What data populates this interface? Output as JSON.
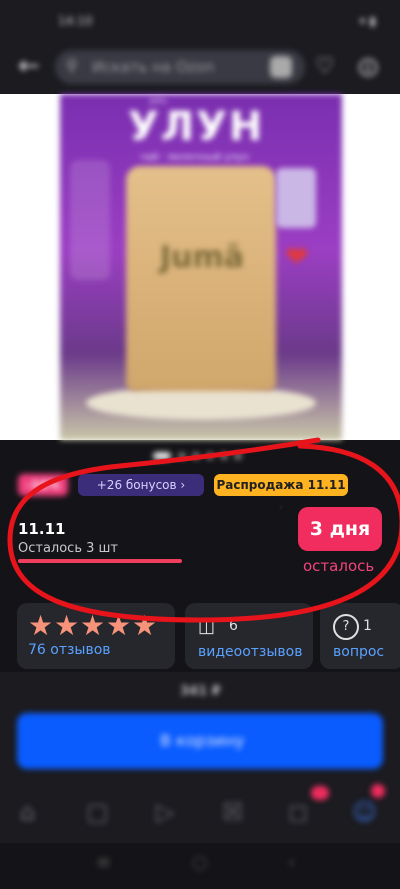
{
  "status_bar": {
    "time": "14:10",
    "right": "▾ ▮"
  },
  "search": {
    "placeholder": "Искать на Ozon"
  },
  "product_image": {
    "title": "УЛУН",
    "subtitle": "чай · молочный улун",
    "brand_small": "Julu",
    "pouch_logo": "Jumā"
  },
  "gallery": {
    "dots_total": 6,
    "active_index": 0
  },
  "badges": {
    "discount": "-16%",
    "bonus": "+26 бонусов",
    "sale": "Распродажа 11.11"
  },
  "sale_block": {
    "date": "11.11",
    "stock_text": "Осталось 3 шт",
    "days_value": "3 дня",
    "days_caption": "осталось"
  },
  "reviews": {
    "stars": 5,
    "reviews_label": "76 отзывов",
    "video_count": "6",
    "video_label": "видеоотзывов",
    "question_count": "1",
    "question_label": "вопрос"
  },
  "purchase": {
    "price": "341 ₽",
    "cart_label": "В корзину"
  },
  "nav": {
    "home_icon": "home-icon",
    "catalog_icon": "catalog-icon",
    "video_icon": "play-icon",
    "favorites_icon": "favorites-icon",
    "cart_icon": "cart-icon",
    "profile_icon": "profile-icon"
  },
  "colors": {
    "accent_pink": "#f02d5e",
    "link_blue": "#5aa2ff",
    "cart_blue": "#0a5cff",
    "sale_orange": "#ffb321",
    "annotation_red": "#e8141b"
  }
}
